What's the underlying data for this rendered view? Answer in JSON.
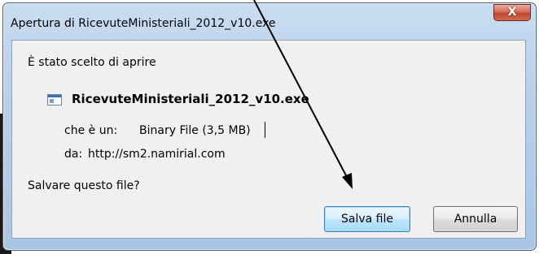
{
  "window": {
    "title": "Apertura di RicevuteMinisteriali_2012_v10.exe",
    "close_glyph": "X"
  },
  "dialog": {
    "intro": "È stato scelto di aprire",
    "filename": "RicevuteMinisteriali_2012_v10.exe",
    "type_label": "che è un:",
    "type_value": "Binary File (3,5 MB)",
    "from_label": "da:",
    "from_value": "http://sm2.namirial.com",
    "question": "Salvare questo file?"
  },
  "buttons": {
    "save": "Salva file",
    "cancel": "Annulla"
  },
  "icons": {
    "file": "exe-file-icon",
    "annotation": "arrow-annotation"
  }
}
